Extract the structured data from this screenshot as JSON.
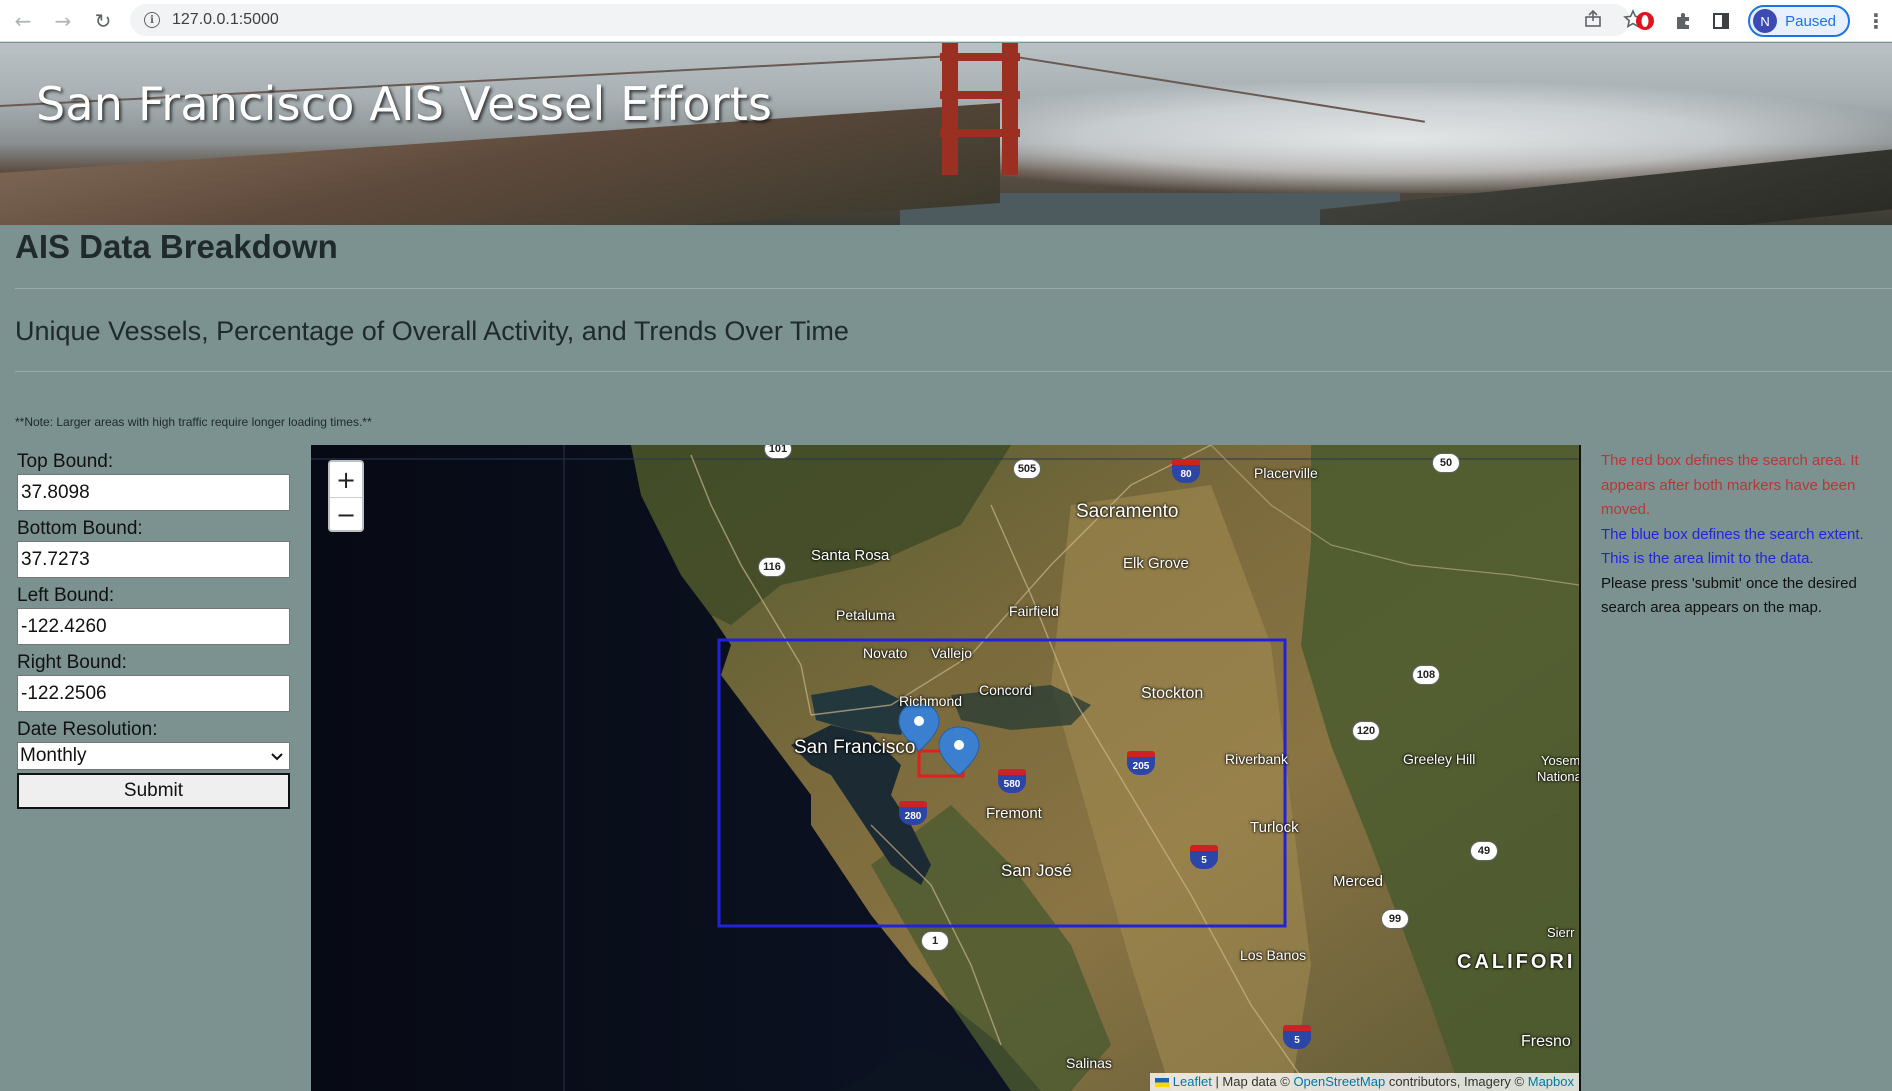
{
  "browser": {
    "url": "127.0.0.1:5000",
    "profile_initial": "N",
    "profile_status": "Paused"
  },
  "header": {
    "title": "San Francisco AIS Vessel Efforts"
  },
  "main": {
    "heading": "AIS Data Breakdown",
    "subheading": "Unique Vessels, Percentage of Overall Activity, and Trends Over Time",
    "note": "**Note: Larger areas with high traffic require longer loading times.**"
  },
  "form": {
    "top_label": "Top Bound:",
    "top_value": "37.8098",
    "bottom_label": "Bottom Bound:",
    "bottom_value": "37.7273",
    "left_label": "Left Bound:",
    "left_value": "-122.4260",
    "right_label": "Right Bound:",
    "right_value": "-122.2506",
    "date_label": "Date Resolution:",
    "date_value": "Monthly",
    "submit_label": "Submit"
  },
  "map": {
    "zoom_in": "+",
    "zoom_out": "−",
    "attribution_leaflet": "Leaflet",
    "attribution_text1": " | Map data © ",
    "attribution_osm": "OpenStreetMap",
    "attribution_text2": " contributors, Imagery © ",
    "attribution_mapbox": "Mapbox",
    "labels": {
      "sacramento": "Sacramento",
      "placerville": "Placerville",
      "santa_rosa": "Santa Rosa",
      "elk_grove": "Elk Grove",
      "petaluma": "Petaluma",
      "fairfield": "Fairfield",
      "novato": "Novato",
      "vallejo": "Vallejo",
      "concord": "Concord",
      "stockton": "Stockton",
      "richmond": "Richmond",
      "san_francisco": "San Francisco",
      "riverbank": "Riverbank",
      "greeley_hill": "Greeley Hill",
      "yosemite": "Yosem",
      "national": "Nationa",
      "fremont": "Fremont",
      "turlock": "Turlock",
      "san_jose": "San José",
      "merced": "Merced",
      "sierra": "Sierr",
      "los_banos": "Los Banos",
      "california": "CALIFORI",
      "fresno": "Fresno",
      "salinas": "Salinas"
    },
    "shields": {
      "r101": "101",
      "r505": "505",
      "i80": "80",
      "r50": "50",
      "r116": "116",
      "r108": "108",
      "r120": "120",
      "i205": "205",
      "i580": "580",
      "i280": "280",
      "r49": "49",
      "i5a": "5",
      "r99": "99",
      "r1": "1",
      "i5b": "5"
    },
    "colors": {
      "search_box": "#e02020",
      "extent_box": "#2222dd",
      "marker": "#3a7fd0"
    }
  },
  "info": {
    "red_text": "The red box defines the search area. It appears after both markers have been moved.",
    "blue_text": "The blue box defines the search extent. This is the area limit to the data.",
    "black_text": "Please press 'submit' once the desired search area appears on the map."
  }
}
